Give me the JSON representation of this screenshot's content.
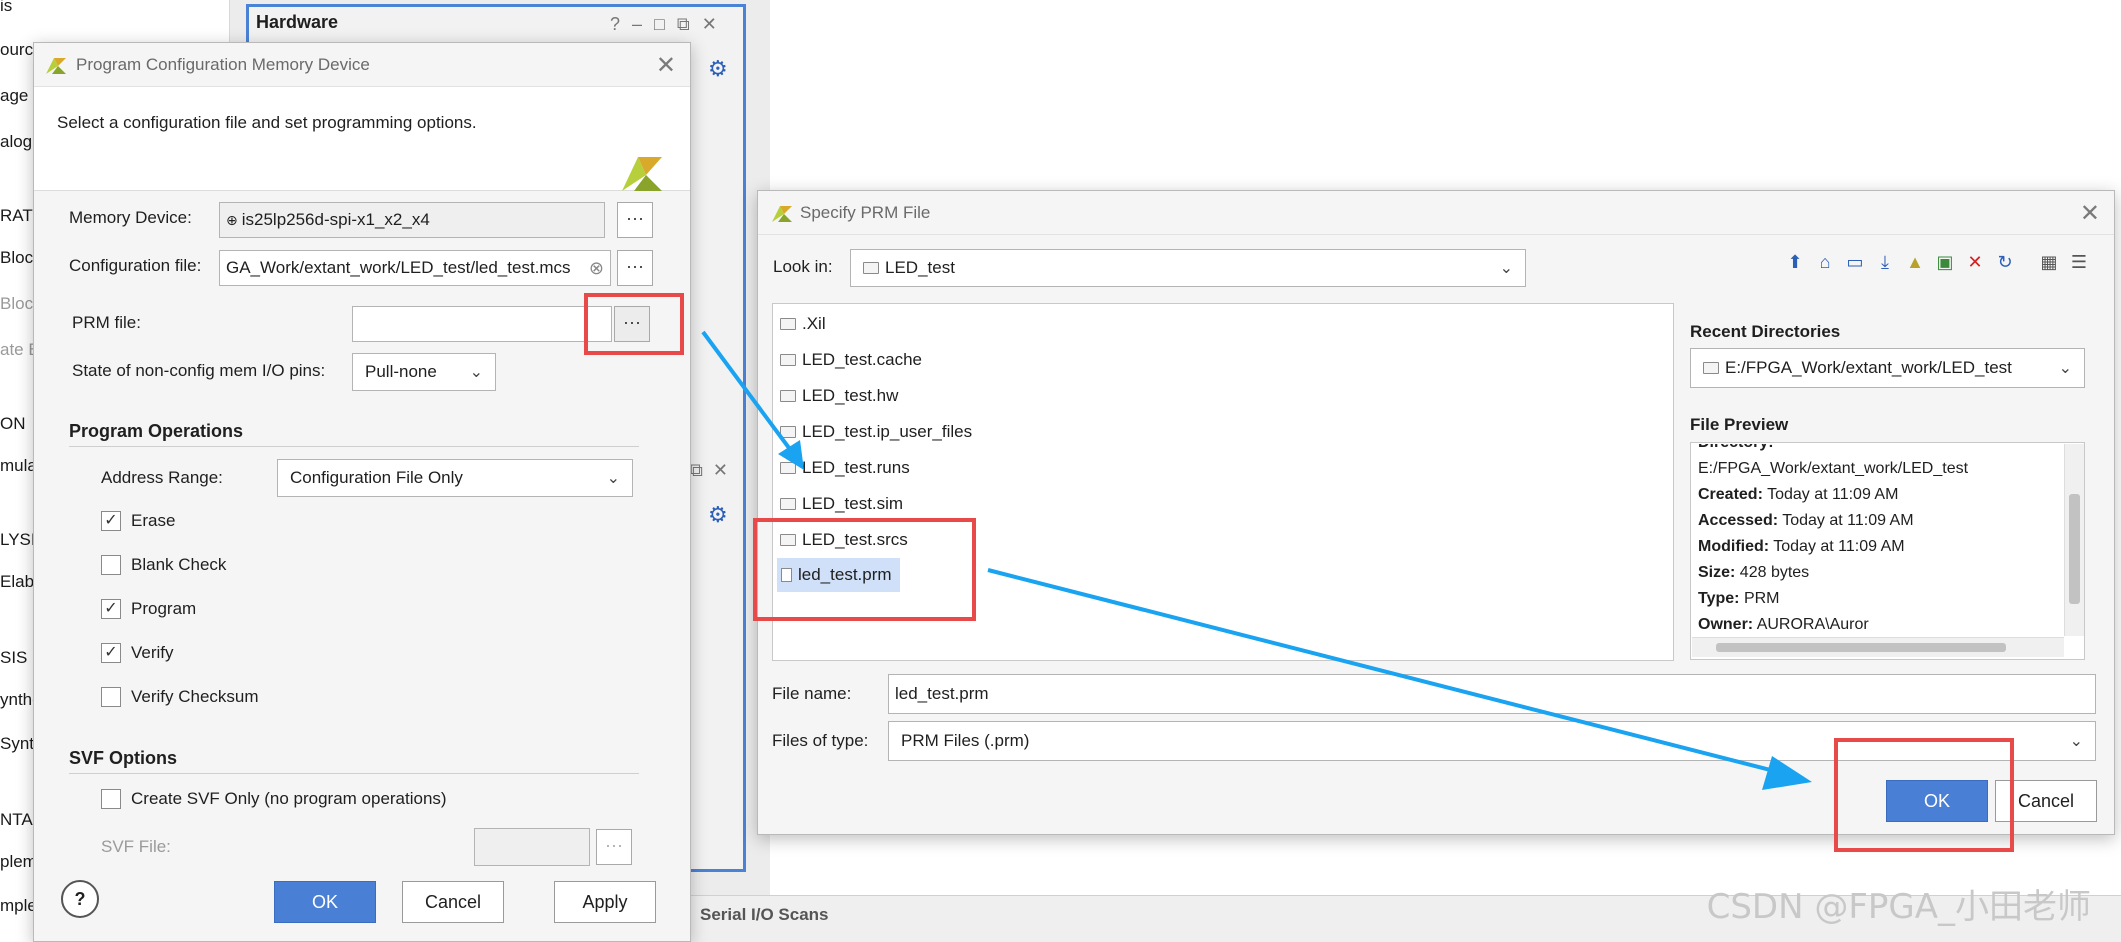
{
  "background": {
    "left_fragments": [
      "is",
      "ource",
      "age T",
      "alog",
      "RATO",
      "Bloc",
      "Block",
      "ate B",
      "ON",
      "mula",
      "LYSIS",
      "Elab",
      "SIS",
      "ynthe",
      "Synt",
      "NTA",
      "pleme",
      "mple"
    ],
    "hardware_title": "Hardware",
    "serial_tab": "Serial I/O Scans",
    "watermark": "CSDN @FPGA_小田老师"
  },
  "program_dialog": {
    "title": "Program Configuration Memory Device",
    "instruction": "Select a configuration file and set programming options.",
    "memory_device_label": "Memory Device:",
    "memory_device_value": "is25lp256d-spi-x1_x2_x4",
    "config_file_label": "Configuration file:",
    "config_file_value": "GA_Work/extant_work/LED_test/led_test.mcs",
    "prm_file_label": "PRM file:",
    "prm_file_value": "",
    "state_label": "State of non-config mem I/O pins:",
    "state_value": "Pull-none",
    "program_operations_title": "Program Operations",
    "address_range_label": "Address Range:",
    "address_range_value": "Configuration File Only",
    "checkboxes": [
      {
        "label": "Erase",
        "checked": true
      },
      {
        "label": "Blank Check",
        "checked": false
      },
      {
        "label": "Program",
        "checked": true
      },
      {
        "label": "Verify",
        "checked": true
      },
      {
        "label": "Verify Checksum",
        "checked": false
      }
    ],
    "svf_title": "SVF Options",
    "svf_checkbox": "Create SVF Only (no program operations)",
    "svf_file_label": "SVF File:",
    "ok": "OK",
    "cancel": "Cancel",
    "apply": "Apply",
    "help": "?"
  },
  "prm_dialog": {
    "title": "Specify PRM File",
    "look_in_label": "Look in:",
    "look_in_value": "LED_test",
    "files": [
      {
        "name": ".Xil",
        "type": "folder"
      },
      {
        "name": "LED_test.cache",
        "type": "folder"
      },
      {
        "name": "LED_test.hw",
        "type": "folder"
      },
      {
        "name": "LED_test.ip_user_files",
        "type": "folder"
      },
      {
        "name": "LED_test.runs",
        "type": "folder"
      },
      {
        "name": "LED_test.sim",
        "type": "folder"
      },
      {
        "name": "LED_test.srcs",
        "type": "folder"
      },
      {
        "name": "led_test.prm",
        "type": "file"
      }
    ],
    "recent_dirs_label": "Recent Directories",
    "recent_dir_value": "E:/FPGA_Work/extant_work/LED_test",
    "file_preview_label": "File Preview",
    "preview": {
      "l0": "Directory:",
      "l1": "E:/FPGA_Work/extant_work/LED_test",
      "created_k": "Created:",
      "created_v": "Today at 11:09 AM",
      "accessed_k": "Accessed:",
      "accessed_v": "Today at 11:09 AM",
      "modified_k": "Modified:",
      "modified_v": "Today at 11:09 AM",
      "size_k": "Size:",
      "size_v": "428 bytes",
      "type_k": "Type:",
      "type_v": "PRM",
      "owner_k": "Owner:",
      "owner_v": "AURORA\\Auror"
    },
    "file_name_label": "File name:",
    "file_name_value": "led_test.prm",
    "files_of_type_label": "Files of type:",
    "files_of_type_value": "PRM Files (.prm)",
    "ok": "OK",
    "cancel": "Cancel"
  },
  "colors": {
    "highlight_red": "#e84a4a",
    "arrow_blue": "#1aa3f0",
    "primary_blue": "#4a7fd6"
  }
}
